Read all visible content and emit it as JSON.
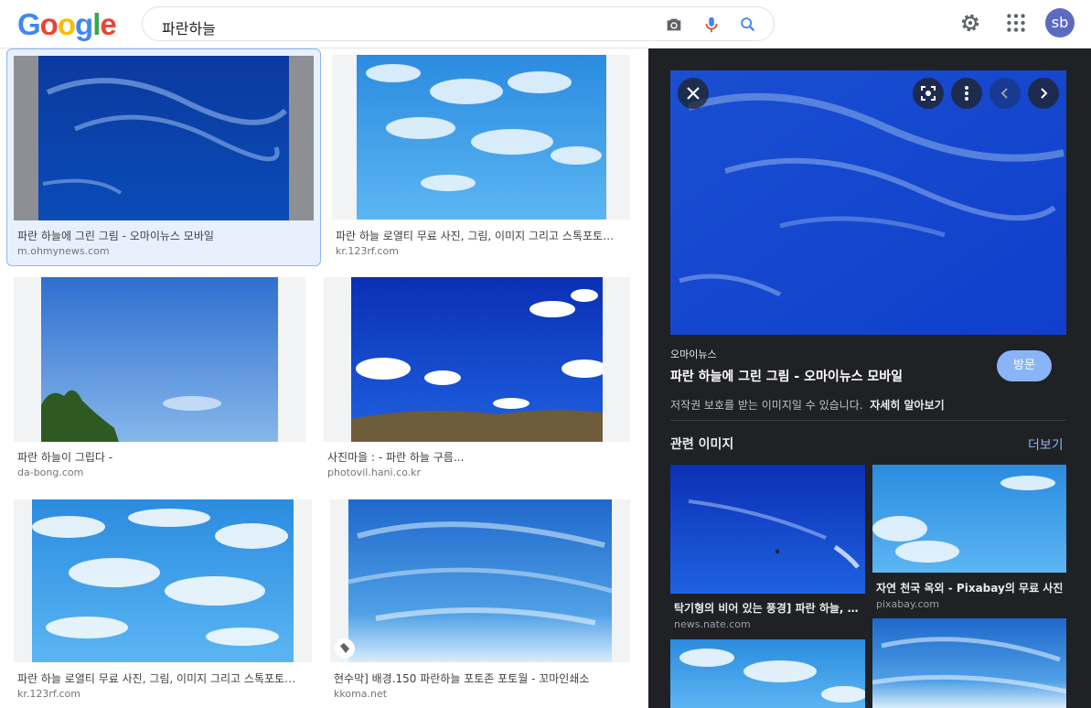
{
  "header": {
    "logo": "Google",
    "search_query": "파란하늘",
    "avatar_initials": "sb"
  },
  "results": [
    {
      "title": "파란 하늘에 그린 그림 - 오마이뉴스 모바일",
      "source": "m.ohmynews.com",
      "selected": true
    },
    {
      "title": "파란 하늘 로열티 무료 사진, 그림, 이미지 그리고 스톡포토그래피. Image...",
      "source": "kr.123rf.com"
    },
    {
      "title": "파란 하늘이 그립다 -",
      "source": "da-bong.com"
    },
    {
      "title": "사진마을 : - 파란 하늘 구름...",
      "source": "photovil.hani.co.kr"
    },
    {
      "title": "파란 하늘 로열티 무료 사진, 그림, 이미지 그리고 스톡포토그래피. Image...",
      "source": "kr.123rf.com"
    },
    {
      "title": "현수막] 배경.150 파란하늘 포토존 포토월 - 꼬마인쇄소",
      "source": "kkoma.net"
    }
  ],
  "panel": {
    "site": "오마이뉴스",
    "title": "파란 하늘에 그린 그림 - 오마이뉴스 모바일",
    "visit_label": "방문",
    "copyright_text": "저작권 보호를 받는 이미지일 수 있습니다.",
    "learn_more": "자세히 알아보기",
    "related_label": "관련 이미지",
    "more_label": "더보기",
    "related": [
      {
        "title": "탁기형의 비어 있는 풍경] 파란 하늘, 새 한 마리",
        "source": "news.nate.com"
      },
      {
        "title": "자연 천국 옥외 - Pixabay의 무료 사진",
        "source": "pixabay.com"
      }
    ]
  },
  "colors": {
    "panel_bg": "#202124",
    "accent": "#8ab4f8",
    "selected_bg": "#e8f0fe"
  }
}
